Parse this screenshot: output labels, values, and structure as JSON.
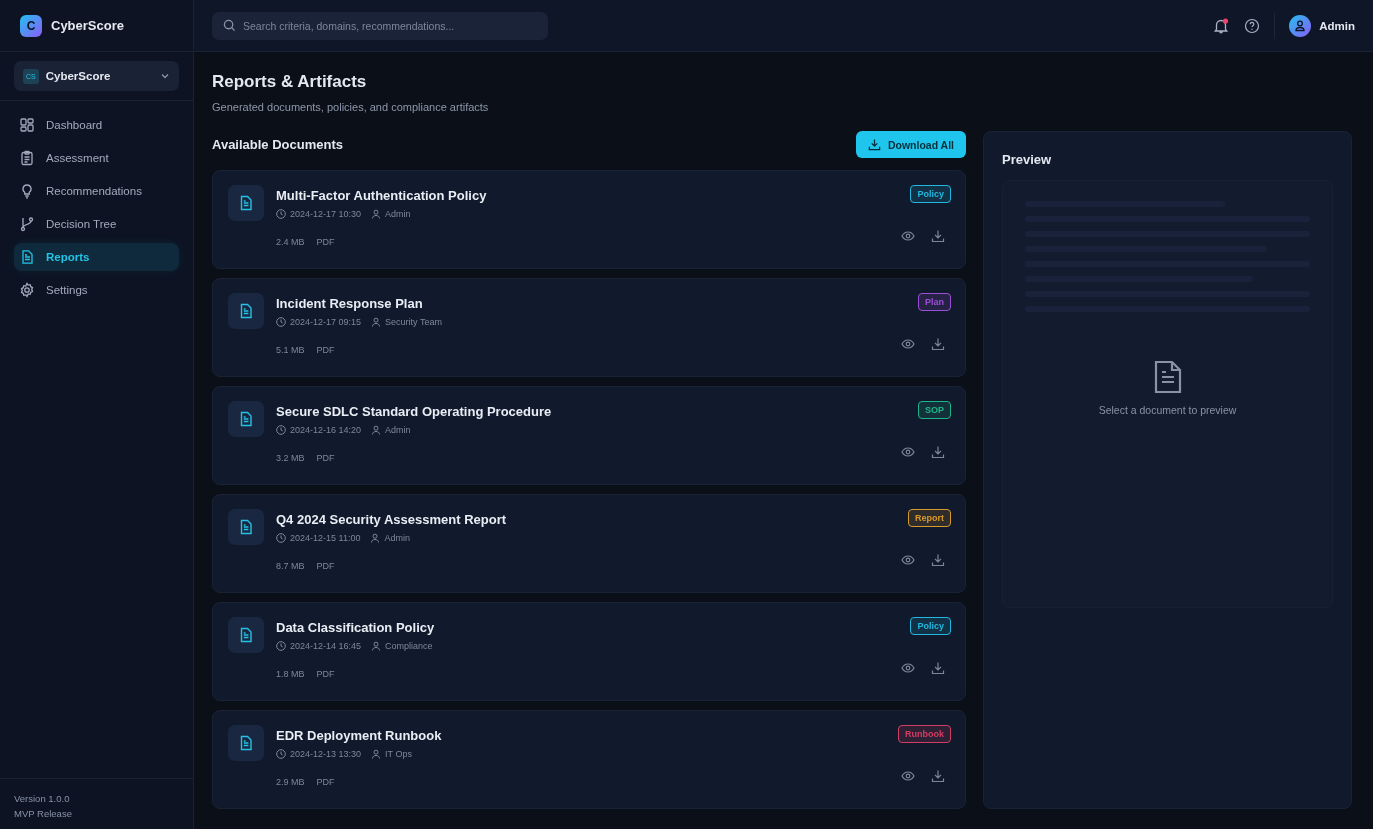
{
  "brand": {
    "logo": "C",
    "name": "CyberScore"
  },
  "search": {
    "placeholder": "Search criteria, domains, recommendations..."
  },
  "topbar": {
    "notification_unread": true,
    "user": "Admin"
  },
  "workspace": {
    "badge": "CS",
    "name": "CyberScore"
  },
  "nav": [
    {
      "label": "Dashboard",
      "selected": false
    },
    {
      "label": "Assessment",
      "selected": false
    },
    {
      "label": "Recommendations",
      "selected": false
    },
    {
      "label": "Decision Tree",
      "selected": false
    },
    {
      "label": "Reports",
      "selected": true
    },
    {
      "label": "Settings",
      "selected": false
    }
  ],
  "sidebar_footer": {
    "version": "Version 1.0.0",
    "release": "MVP Release"
  },
  "page": {
    "title": "Reports & Artifacts",
    "subtitle": "Generated documents, policies, and compliance artifacts"
  },
  "documents_header": {
    "title": "Available Documents",
    "button": "Download All"
  },
  "documents": [
    {
      "title": "Multi-Factor Authentication Policy",
      "date": "2024-12-17 10:30",
      "author": "Admin",
      "size": "2.4 MB",
      "format": "PDF",
      "tag": "Policy",
      "color": "#22b8e0"
    },
    {
      "title": "Incident Response Plan",
      "date": "2024-12-17 09:15",
      "author": "Security Team",
      "size": "5.1 MB",
      "format": "PDF",
      "tag": "Plan",
      "color": "#9b4fd6"
    },
    {
      "title": "Secure SDLC Standard Operating Procedure",
      "date": "2024-12-16 14:20",
      "author": "Admin",
      "size": "3.2 MB",
      "format": "PDF",
      "tag": "SOP",
      "color": "#1fb58a"
    },
    {
      "title": "Q4 2024 Security Assessment Report",
      "date": "2024-12-15 11:00",
      "author": "Admin",
      "size": "8.7 MB",
      "format": "PDF",
      "tag": "Report",
      "color": "#d99a2b"
    },
    {
      "title": "Data Classification Policy",
      "date": "2024-12-14 16:45",
      "author": "Compliance",
      "size": "1.8 MB",
      "format": "PDF",
      "tag": "Policy",
      "color": "#22b8e0"
    },
    {
      "title": "EDR Deployment Runbook",
      "date": "2024-12-13 13:30",
      "author": "IT Ops",
      "size": "2.9 MB",
      "format": "PDF",
      "tag": "Runbook",
      "color": "#d23d63"
    }
  ],
  "preview": {
    "title": "Preview",
    "empty_text": "Select a document to preview"
  }
}
